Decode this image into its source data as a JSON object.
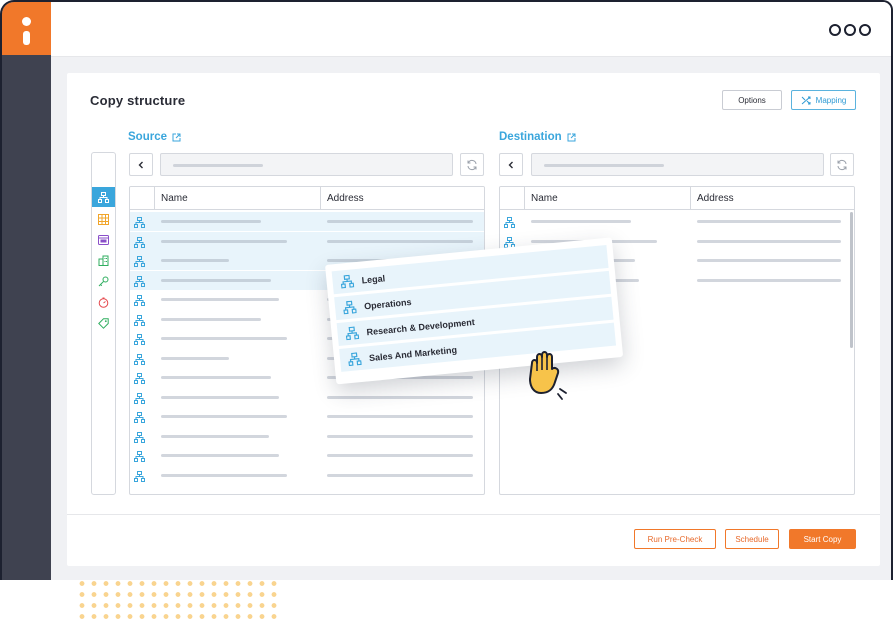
{
  "panel": {
    "title": "Copy structure",
    "options_label": "Options",
    "mapping_label": "Mapping"
  },
  "source": {
    "title": "Source",
    "columns": [
      "Name",
      "Address"
    ]
  },
  "destination": {
    "title": "Destination",
    "columns": [
      "Name",
      "Address"
    ]
  },
  "sidebar": {
    "icons": [
      "org-structure-icon",
      "table-icon",
      "calendar-icon",
      "building-icon",
      "key-icon",
      "timer-icon",
      "tag-icon"
    ],
    "active_index": 0
  },
  "drag_items": [
    "Legal",
    "Operations",
    "Research & Development",
    "Sales And Marketing"
  ],
  "footer": {
    "precheck_label": "Run Pre-Check",
    "schedule_label": "Schedule",
    "start_label": "Start Copy"
  },
  "colors": {
    "accent": "#f1782a",
    "blue": "#3aa6dc",
    "dark": "#3f4250"
  }
}
